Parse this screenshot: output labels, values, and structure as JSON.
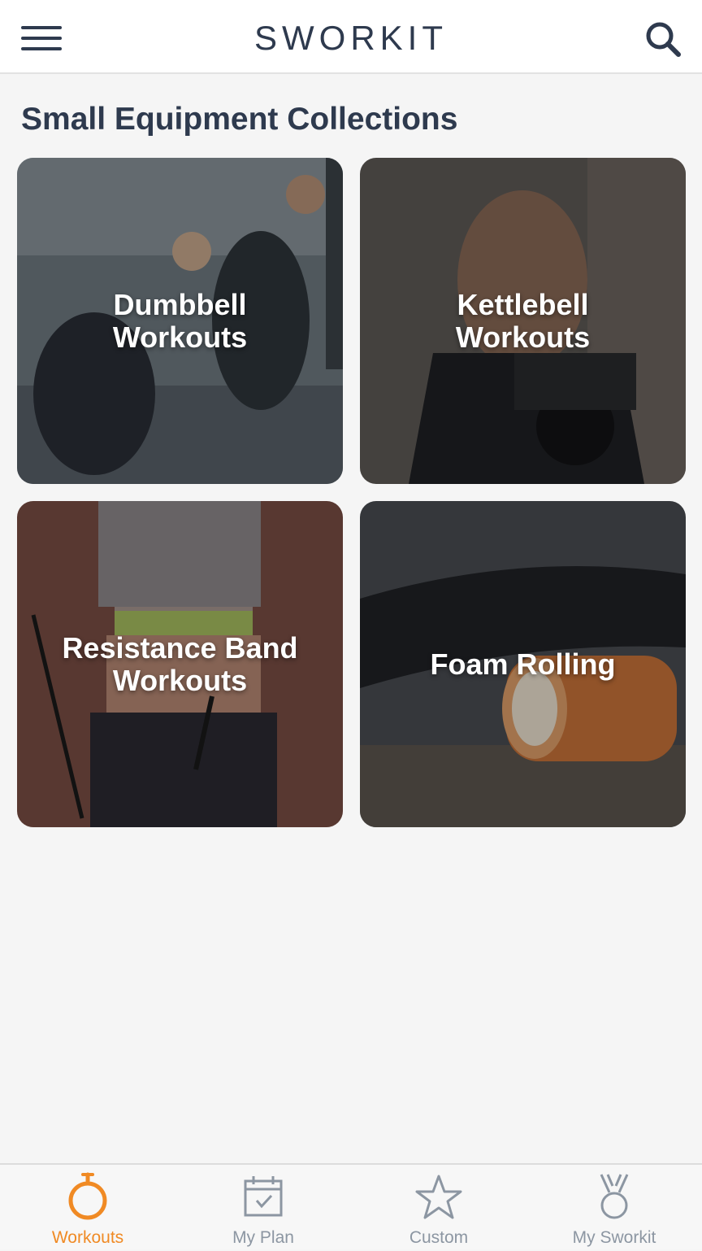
{
  "header": {
    "logo_text": "SWORKIT",
    "menu_icon": "hamburger-menu-icon",
    "search_icon": "search-icon"
  },
  "section": {
    "title": "Small Equipment Collections"
  },
  "collections": [
    {
      "label": "Dumbbell\nWorkouts",
      "image": "people-lunging-with-dumbbells"
    },
    {
      "label": "Kettlebell\nWorkouts",
      "image": "woman-holding-kettlebell"
    },
    {
      "label": "Resistance Band\nWorkouts",
      "image": "woman-with-resistance-band"
    },
    {
      "label": "Foam Rolling",
      "image": "foam-roller-on-floor"
    }
  ],
  "tabs": [
    {
      "label": "Workouts",
      "icon": "stopwatch-icon",
      "active": true
    },
    {
      "label": "My Plan",
      "icon": "calendar-check-icon",
      "active": false
    },
    {
      "label": "Custom",
      "icon": "star-icon",
      "active": false
    },
    {
      "label": "My Sworkit",
      "icon": "medal-icon",
      "active": false
    }
  ],
  "colors": {
    "accent": "#f08a24",
    "text_dark": "#2e3a4e",
    "tab_inactive": "#8c96a2",
    "background": "#f5f5f5"
  }
}
